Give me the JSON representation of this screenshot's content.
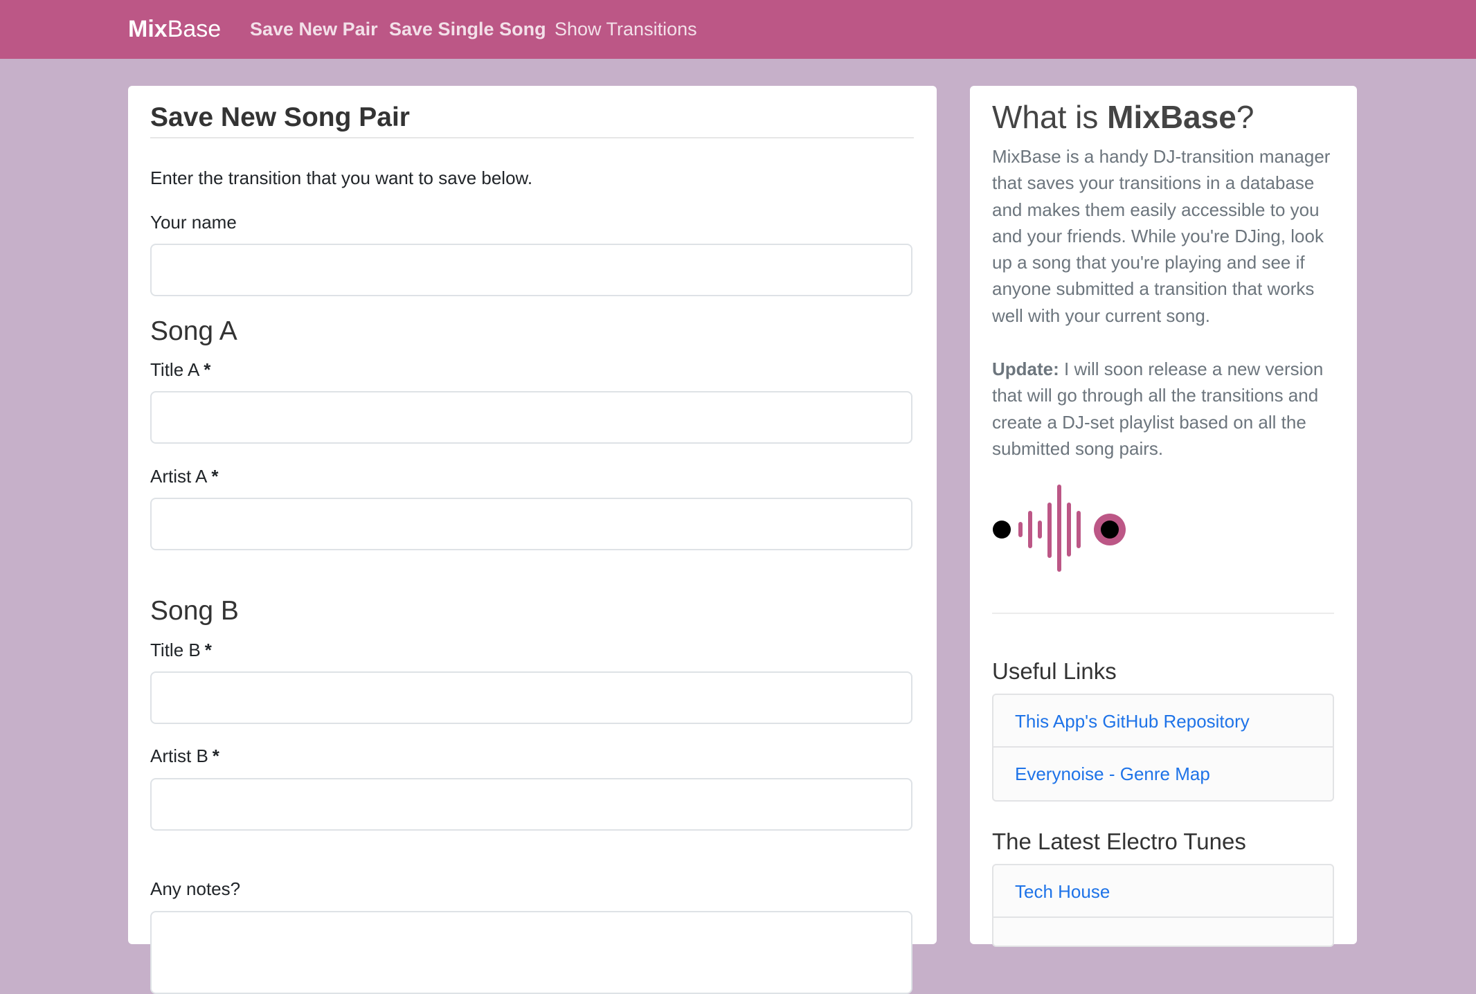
{
  "navbar": {
    "brand_bold": "Mix",
    "brand_rest": "Base",
    "links": [
      "Save New Pair",
      "Save Single Song",
      "Show Transitions"
    ]
  },
  "form": {
    "title": "Save New Song Pair",
    "intro": "Enter the transition that you want to save below.",
    "name_label": "Your name",
    "song_a_heading": "Song A",
    "title_a_label": "Title A",
    "artist_a_label": "Artist A",
    "song_b_heading": "Song B",
    "title_b_label": "Title B",
    "artist_b_label": "Artist B",
    "required_marker": "*",
    "notes_label": "Any notes?"
  },
  "sidebar": {
    "title_prefix": "What is ",
    "title_bold": "MixBase",
    "title_suffix": "?",
    "description": "MixBase is a handy DJ-transition manager that saves your transitions in a database and makes them easily accessible to you and your friends. While you're DJing, look up a song that you're playing and see if anyone submitted a transition that works well with your current song.",
    "update_label": "Update:",
    "update_text": " I will soon release a new version that will go through all the transitions and create a DJ-set playlist based on all the submitted song pairs.",
    "useful_links_heading": "Useful Links",
    "useful_links": [
      "This App's GitHub Repository",
      "Everynoise - Genre Map"
    ],
    "electro_heading": "The Latest Electro Tunes",
    "electro_links": [
      "Tech House"
    ]
  },
  "colors": {
    "navbar": "#bc5786",
    "background": "#c6b0c9",
    "accent": "#bc5786",
    "link": "#1e73e8"
  },
  "icons": {
    "logo": "soundwave-logo-icon"
  }
}
